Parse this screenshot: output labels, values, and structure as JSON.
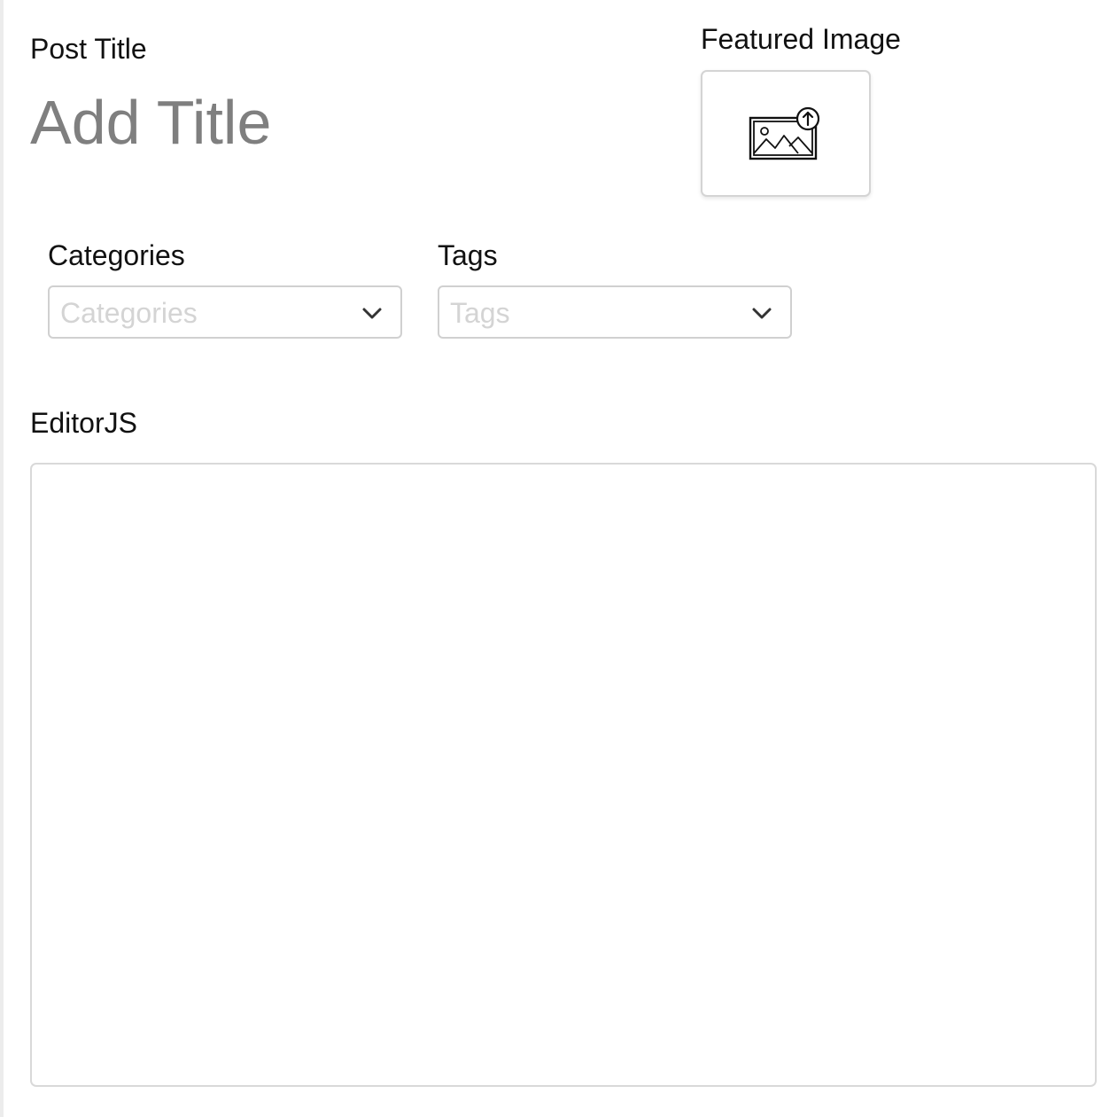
{
  "post_title": {
    "label": "Post Title",
    "placeholder": "Add Title",
    "value": ""
  },
  "featured_image": {
    "label": "Featured Image",
    "icon": "image-upload-icon"
  },
  "categories": {
    "label": "Categories",
    "placeholder": "Categories",
    "icon": "chevron-down-icon"
  },
  "tags": {
    "label": "Tags",
    "placeholder": "Tags",
    "icon": "chevron-down-icon"
  },
  "editor": {
    "label": "EditorJS"
  },
  "colors": {
    "placeholder_gray": "#7f7f7f",
    "border_gray": "#d0d0d0",
    "page_left_border": "#ececec"
  }
}
